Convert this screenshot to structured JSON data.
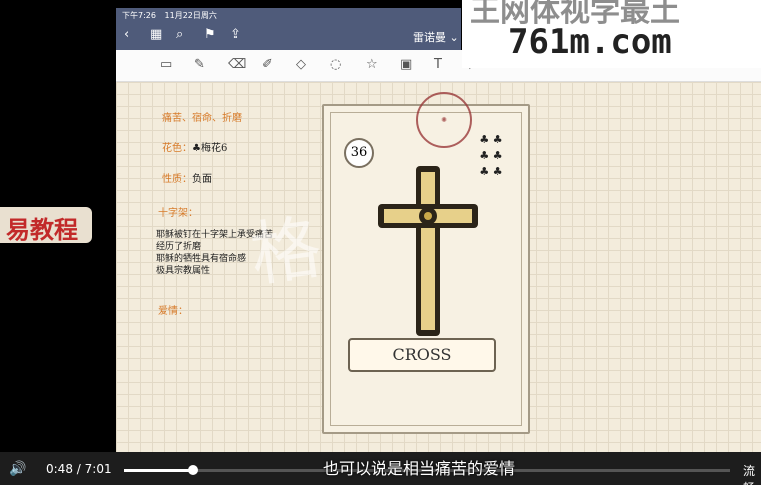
{
  "status": {
    "time": "下午7:26",
    "date": "11月22日周六"
  },
  "appbar": {
    "title": "雷诺曼",
    "dropdown_icon": "chevron-down-icon"
  },
  "toolbar": {
    "icons": [
      "notebook-icon",
      "pen-icon",
      "eraser-icon",
      "highlighter-icon",
      "shapes-icon",
      "lasso-icon",
      "sticker-icon",
      "image-icon",
      "text-icon",
      "more-icon"
    ]
  },
  "notes": {
    "keywords": "痛苦、宿命、折磨",
    "suit_label": "花色：",
    "suit_value": "梅花6",
    "nature_label": "性质：",
    "nature_value": "负面",
    "cross_label": "十字架：",
    "line1": "耶稣被钉在十字架上承受痛苦",
    "line2": "经历了折磨",
    "line3": "耶稣的牺牲具有宿命感",
    "line4": "极具宗教属性",
    "love_label": "爱情："
  },
  "card": {
    "number": "36",
    "name": "CROSS",
    "clubs": "♣ ♣\n♣ ♣\n♣ ♣"
  },
  "watermark_text": "格",
  "left_label": "易教程",
  "site": {
    "line1": "王网体视学最土",
    "line2": "761m.com"
  },
  "player": {
    "current": "0:48",
    "separator": "/",
    "duration": "7:01",
    "progress": 0.114,
    "subtitle": "也可以说是相当痛苦的爱情",
    "quality": "流畅"
  }
}
